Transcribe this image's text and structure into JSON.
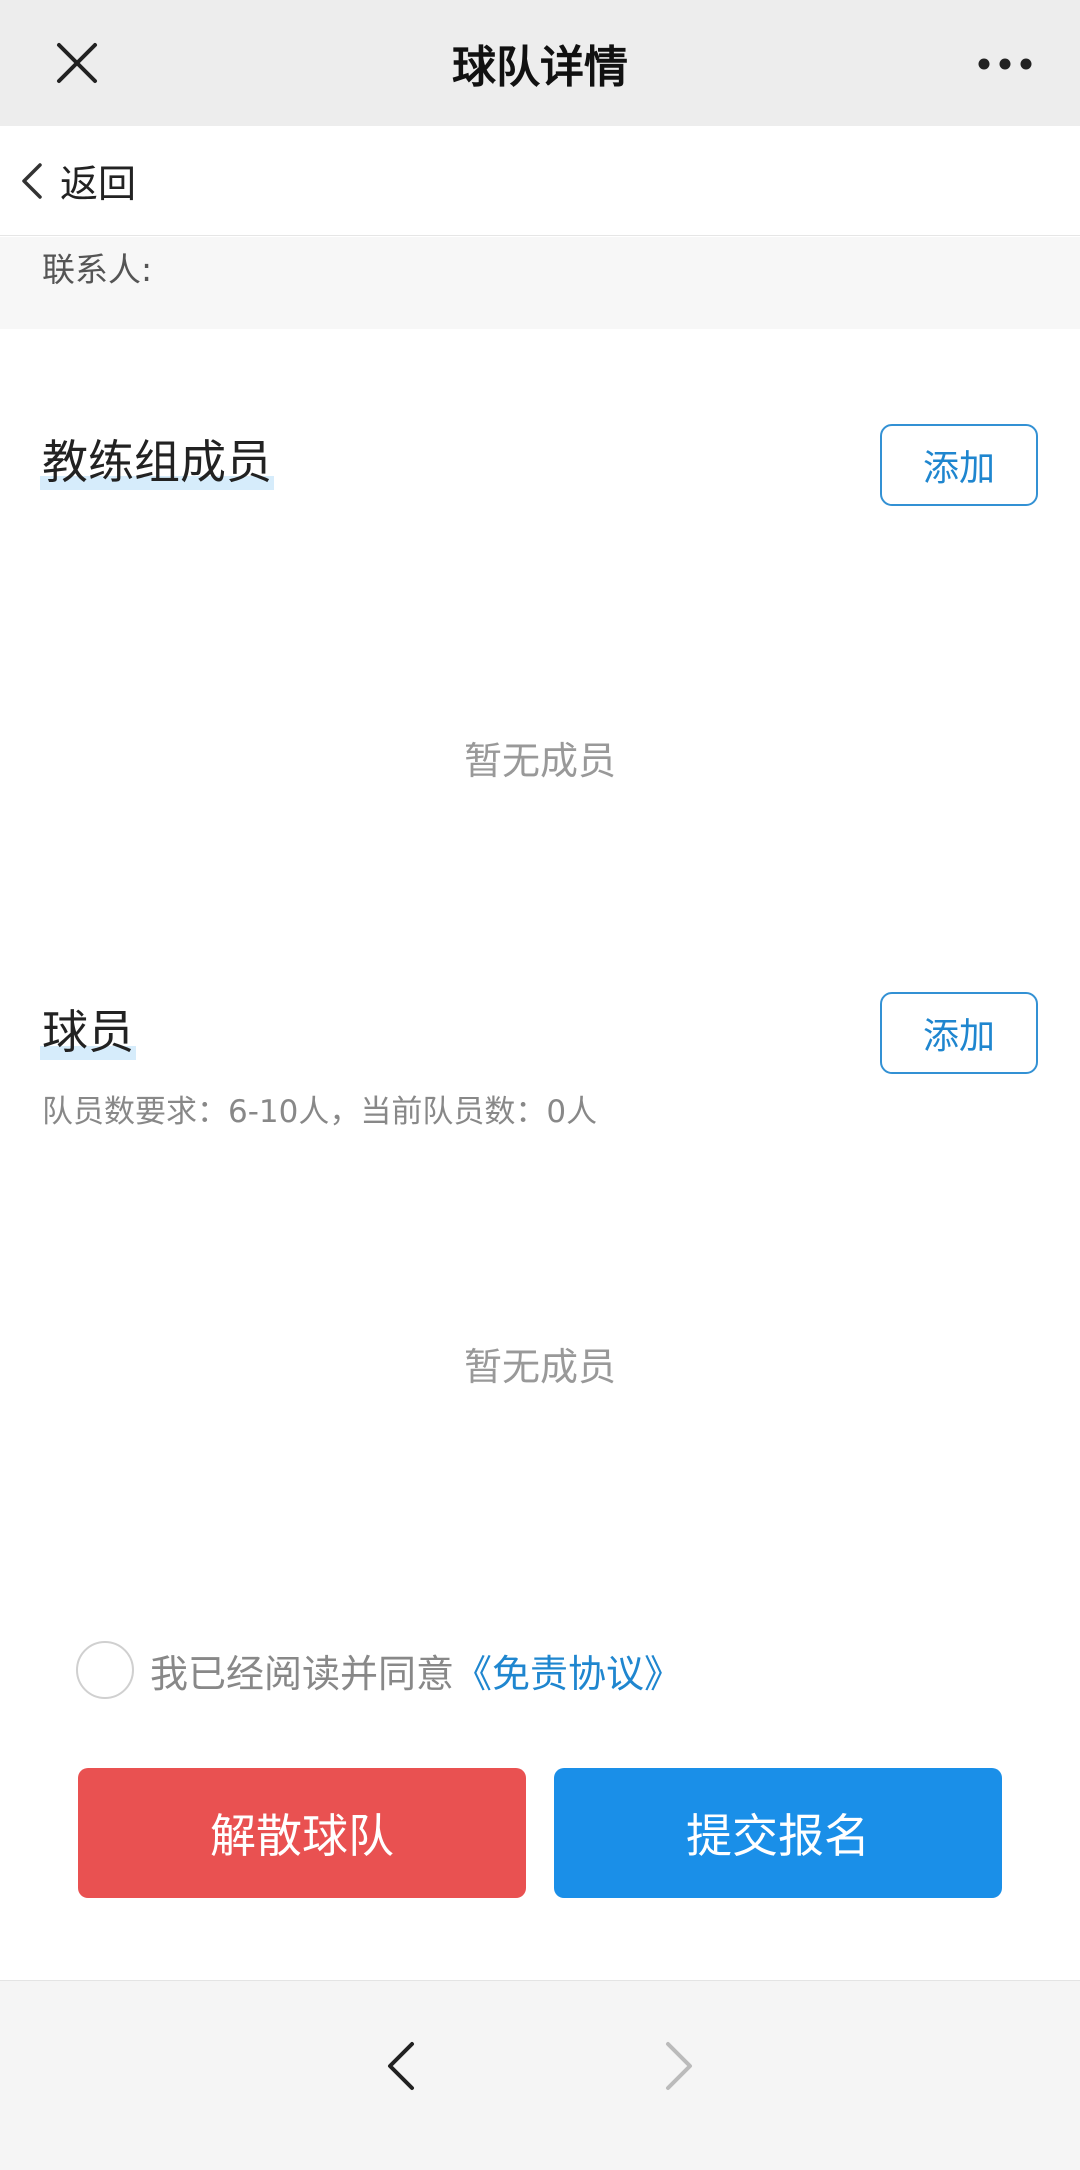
{
  "titlebar": {
    "title": "球队详情",
    "close_icon": "close-icon",
    "more_icon": "more-icon"
  },
  "backbar": {
    "back_label": "返回",
    "back_icon": "chevron-left-icon"
  },
  "contact": {
    "label": "联系人:"
  },
  "coaches": {
    "title": "教练组成员",
    "add_label": "添加",
    "empty_text": "暂无成员"
  },
  "players": {
    "title": "球员",
    "add_label": "添加",
    "hint": "队员数要求：6-10人，当前队员数：0人",
    "empty_text": "暂无成员"
  },
  "agreement": {
    "checked": false,
    "text": "我已经阅读并同意",
    "link": "《免责协议》"
  },
  "actions": {
    "dissolve_label": "解散球队",
    "submit_label": "提交报名"
  },
  "bottom_nav": {
    "prev_icon": "chevron-left-icon",
    "next_icon": "chevron-right-icon",
    "prev_enabled": true,
    "next_enabled": false
  },
  "colors": {
    "accent": "#1f86cf",
    "danger": "#e95151",
    "primary": "#1a8fe8",
    "highlight": "#d6ecfb"
  }
}
